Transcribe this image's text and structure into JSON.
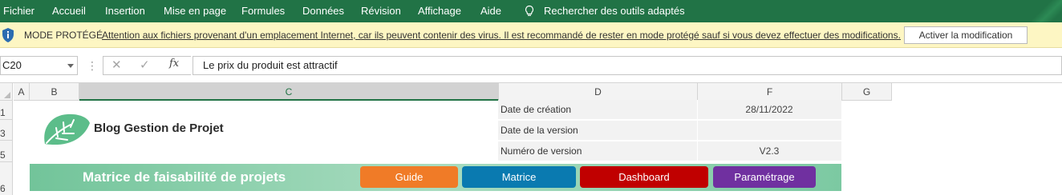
{
  "ribbon": {
    "tabs": [
      "Fichier",
      "Accueil",
      "Insertion",
      "Mise en page",
      "Formules",
      "Données",
      "Révision",
      "Affichage",
      "Aide"
    ],
    "search_label": "Rechercher des outils adaptés",
    "bg_color": "#217346"
  },
  "protected": {
    "mode_label": "MODE PROTÉGÉ",
    "message": "Attention aux fichiers provenant d'un emplacement Internet, car ils peuvent contenir des virus. Il est recommandé de rester en mode protégé sauf si vous devez effectuer des modifications.",
    "enable_button": "Activer la modification",
    "bg_color": "#fdf6c3"
  },
  "formula_bar": {
    "name_box": "C20",
    "dots": "⋮",
    "cancel_icon": "✕",
    "enter_icon": "✓",
    "fx_label": "fx",
    "content": "Le prix du produit est attractif"
  },
  "columns": [
    "A",
    "B",
    "C",
    "D",
    "F",
    "G"
  ],
  "selected_column": "C",
  "rows": [
    "1",
    "3",
    "5",
    "6"
  ],
  "logo": {
    "name": "Blog Gestion de Projet",
    "color": "#5cbd8a"
  },
  "info": [
    {
      "label": "Date de création",
      "value": "28/11/2022"
    },
    {
      "label": "Date de la version",
      "value": ""
    },
    {
      "label": "Numéro de version",
      "value": "V2.3"
    }
  ],
  "banner": {
    "title": "Matrice de faisabilité de projets",
    "buttons": [
      {
        "label": "Guide",
        "color": "#f07b27"
      },
      {
        "label": "Matrice",
        "color": "#0a7ab0"
      },
      {
        "label": "Dashboard",
        "color": "#c00000"
      },
      {
        "label": "Paramétrage",
        "color": "#7030a0"
      }
    ]
  }
}
